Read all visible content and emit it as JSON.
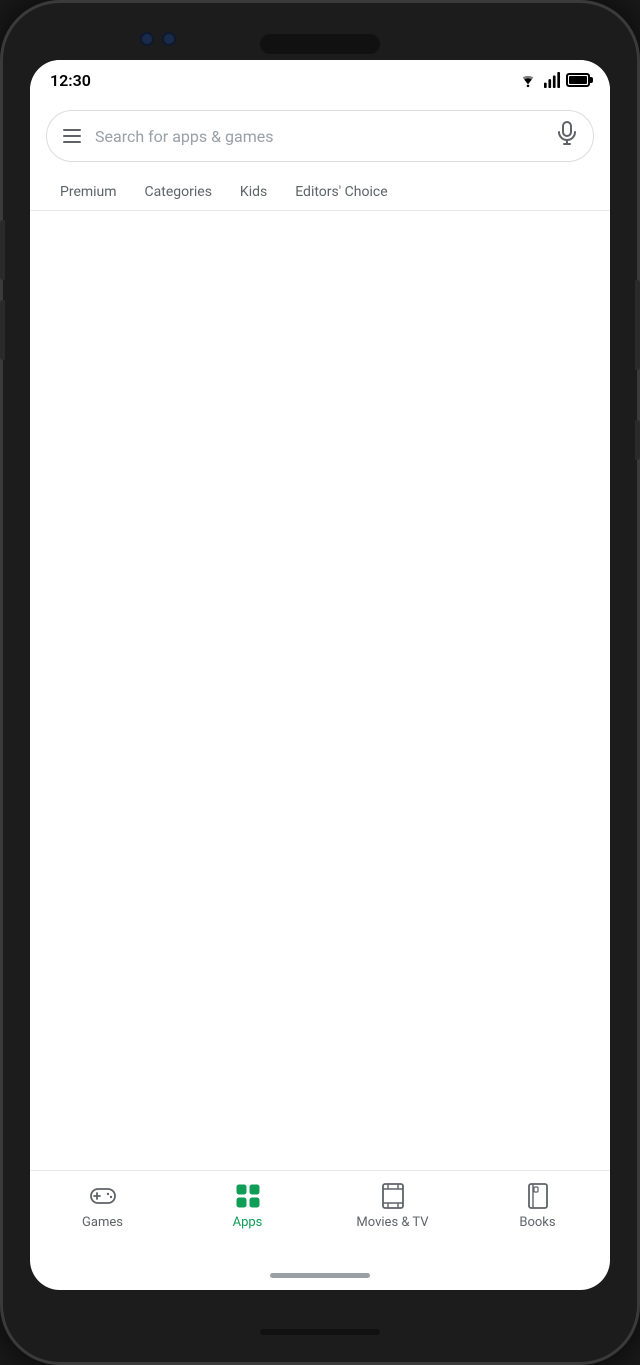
{
  "phone": {
    "status_bar": {
      "time": "12:30"
    },
    "search_bar": {
      "placeholder": "Search for apps & games"
    },
    "tabs": [
      {
        "id": "premium",
        "label": "Premium",
        "active": false
      },
      {
        "id": "categories",
        "label": "Categories",
        "active": false
      },
      {
        "id": "kids",
        "label": "Kids",
        "active": false
      },
      {
        "id": "editors_choice",
        "label": "Editors' Choice",
        "active": false
      }
    ],
    "bottom_nav": [
      {
        "id": "games",
        "label": "Games",
        "active": false,
        "icon": "gamepad"
      },
      {
        "id": "apps",
        "label": "Apps",
        "active": true,
        "icon": "apps"
      },
      {
        "id": "movies_tv",
        "label": "Movies & TV",
        "active": false,
        "icon": "film"
      },
      {
        "id": "books",
        "label": "Books",
        "active": false,
        "icon": "book"
      }
    ]
  }
}
